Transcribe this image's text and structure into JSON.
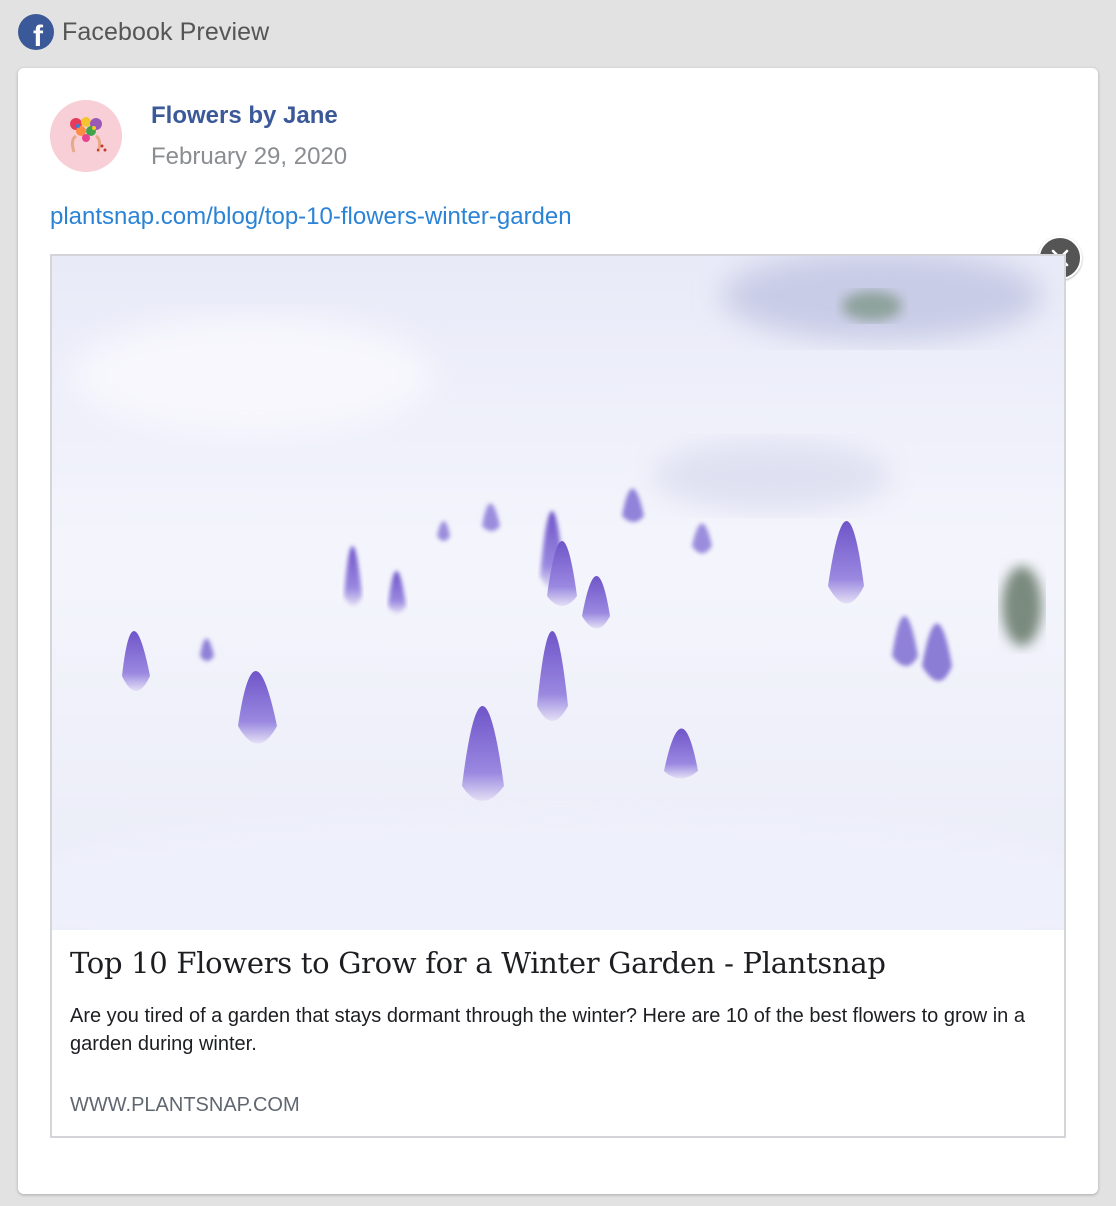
{
  "header": {
    "title": "Facebook Preview",
    "icon": "facebook-logo-icon",
    "brand_color": "#3b5998"
  },
  "post": {
    "page_name": "Flowers by Jane",
    "date": "February 29, 2020",
    "link_url": "plantsnap.com/blog/top-10-flowers-winter-garden"
  },
  "link_preview": {
    "title": "Top 10 Flowers to Grow for a Winter Garden - Plantsnap",
    "description": "Are you tired of a garden that stays dormant through the winter? Here are 10 of the best flowers to grow in a garden during winter.",
    "domain": "WWW.PLANTSNAP.COM",
    "image": "purple-crocus-buds-in-snow"
  },
  "close_icon": "close-icon"
}
